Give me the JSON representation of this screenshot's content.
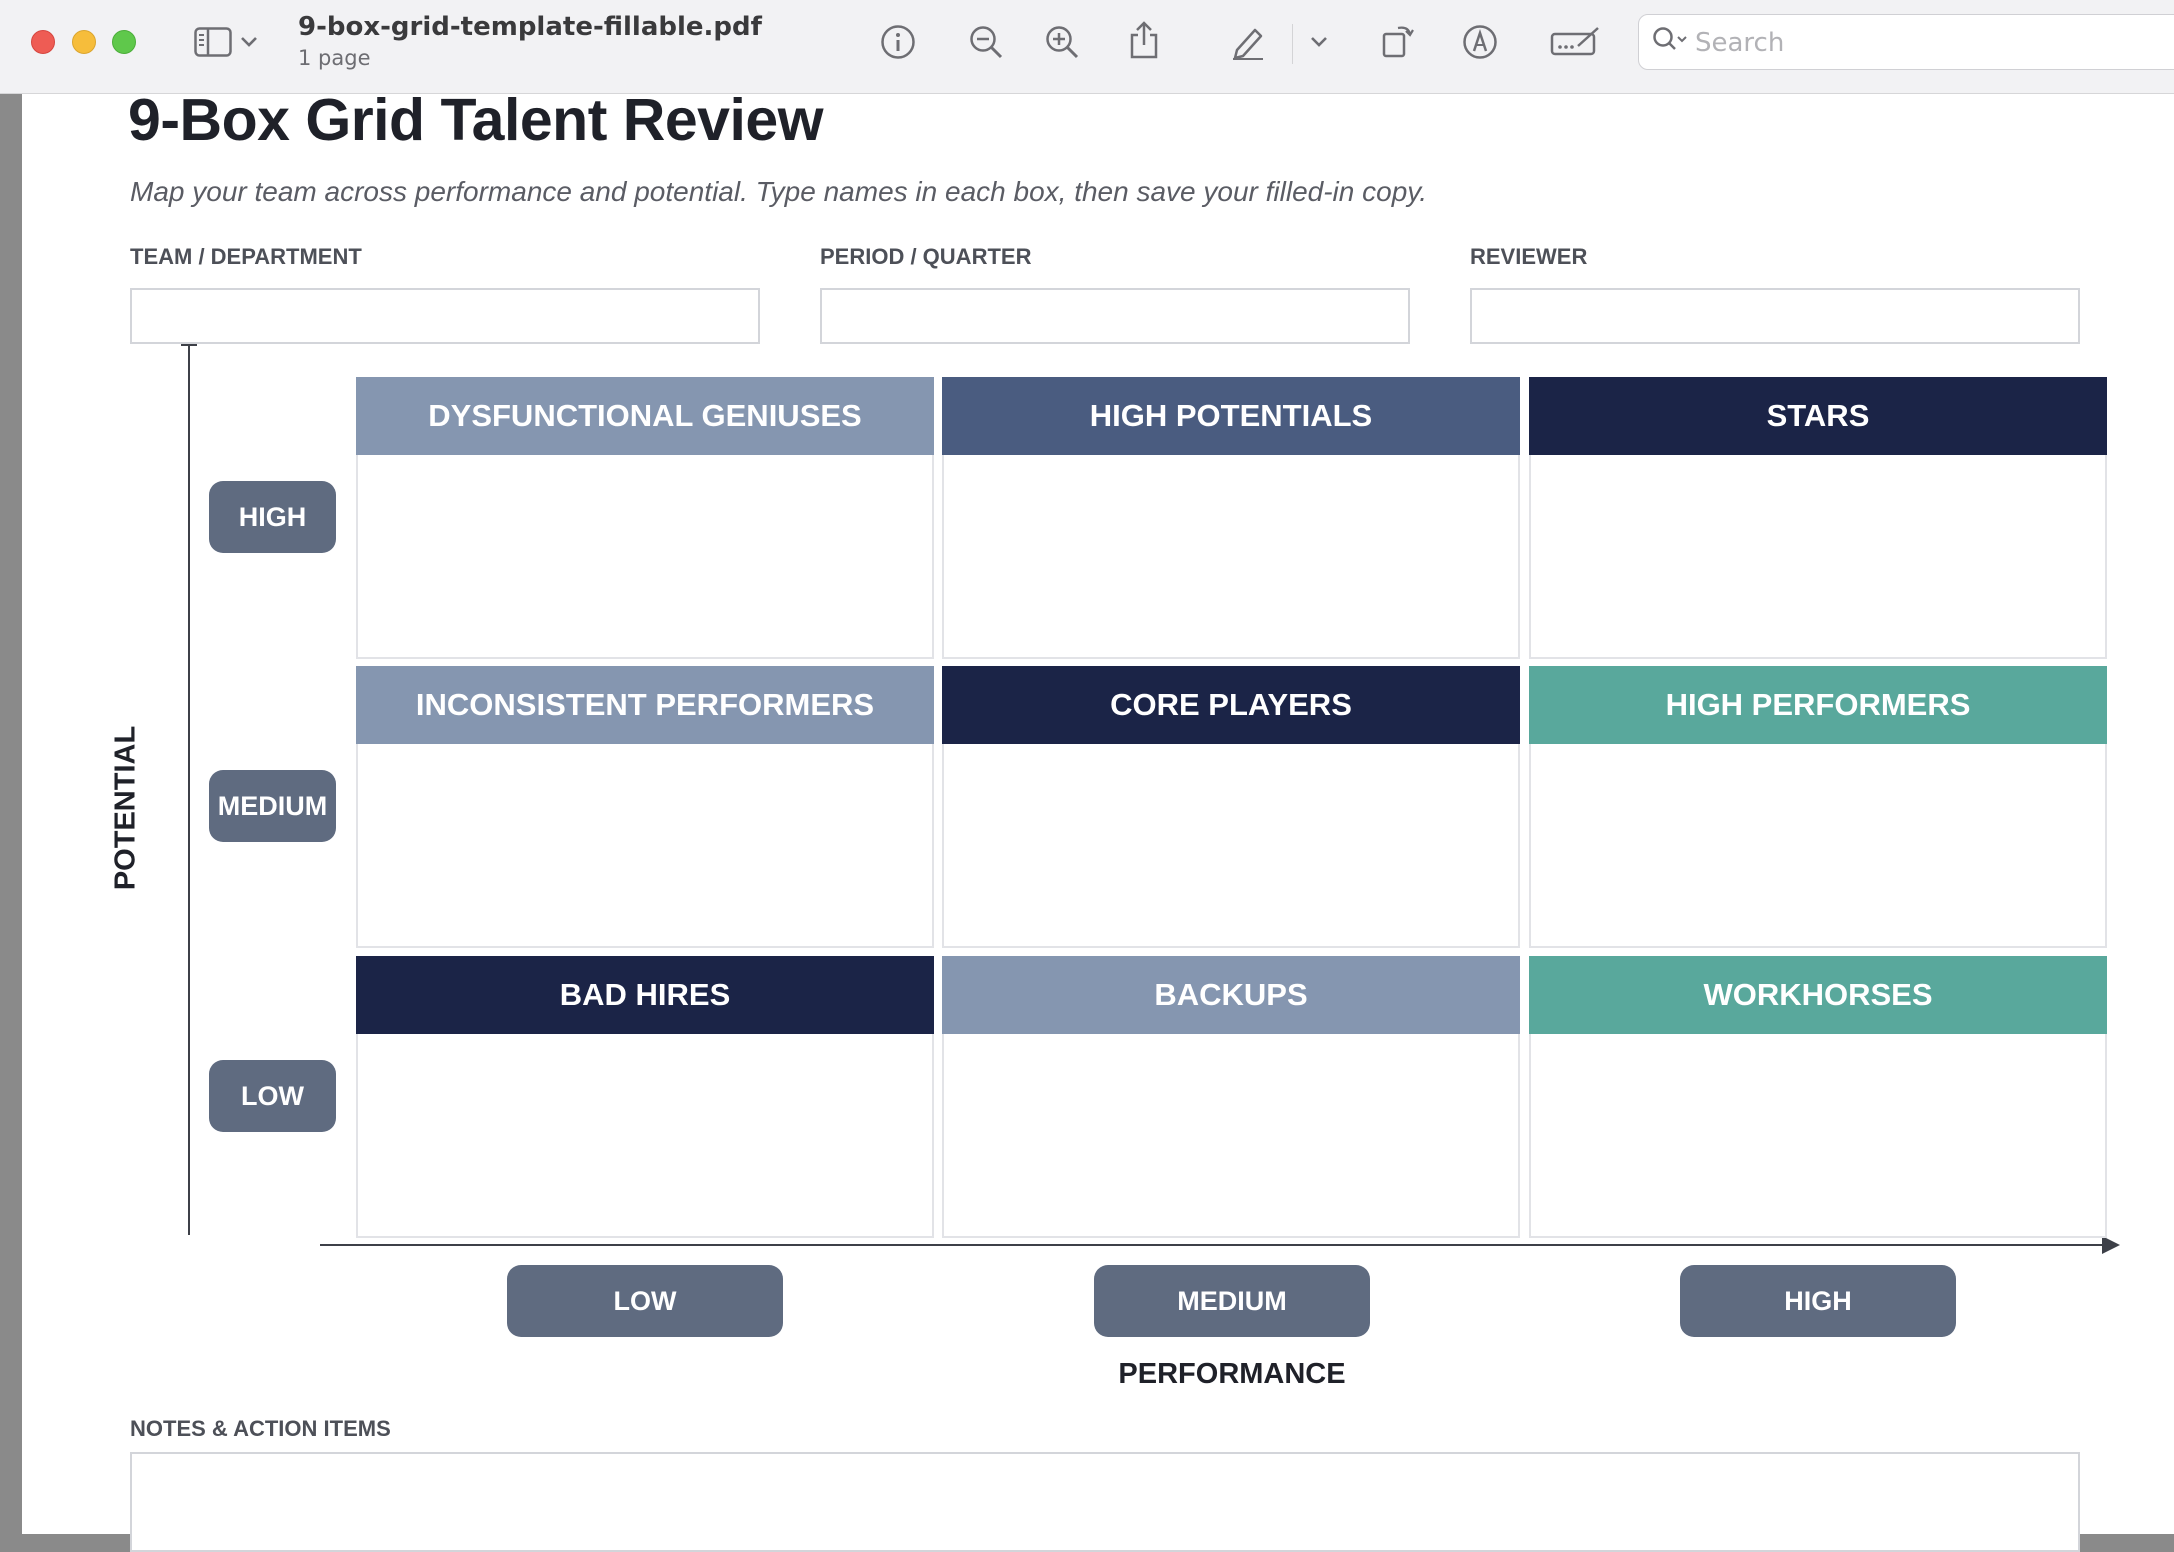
{
  "window": {
    "file_name": "9-box-grid-template-fillable.pdf",
    "page_count": "1 page"
  },
  "toolbar": {
    "icons": [
      "sidebar-icon",
      "chevron-down-icon",
      "info-icon",
      "zoom-out-icon",
      "zoom-in-icon",
      "share-icon",
      "highlighter-pen-icon",
      "chevron-down-icon",
      "rotate-icon",
      "markup-icon",
      "form-fill-icon",
      "search-icon"
    ],
    "search_placeholder": "Search"
  },
  "document": {
    "title": "9-Box Grid Talent Review",
    "subtitle": "Map your team across performance and potential. Type names in each box, then save your filled-in copy.",
    "fields": {
      "team_label": "TEAM / DEPARTMENT",
      "team_value": "",
      "period_label": "PERIOD / QUARTER",
      "period_value": "",
      "reviewer_label": "REVIEWER",
      "reviewer_value": ""
    },
    "axes": {
      "y_title": "POTENTIAL",
      "y_levels": [
        "HIGH",
        "MEDIUM",
        "LOW"
      ],
      "x_title": "PERFORMANCE",
      "x_levels": [
        "LOW",
        "MEDIUM",
        "HIGH"
      ]
    },
    "grid": {
      "rows": [
        [
          {
            "label": "DYSFUNCTIONAL GENIUSES",
            "color": "#8596b0",
            "value": ""
          },
          {
            "label": "HIGH POTENTIALS",
            "color": "#4a5c80",
            "value": ""
          },
          {
            "label": "STARS",
            "color": "#1b2447",
            "value": ""
          }
        ],
        [
          {
            "label": "INCONSISTENT PERFORMERS",
            "color": "#8596b0",
            "value": ""
          },
          {
            "label": "CORE PLAYERS",
            "color": "#1b2447",
            "value": ""
          },
          {
            "label": "HIGH PERFORMERS",
            "color": "#59a89c",
            "value": ""
          }
        ],
        [
          {
            "label": "BAD HIRES",
            "color": "#1b2447",
            "value": ""
          },
          {
            "label": "BACKUPS",
            "color": "#8596b0",
            "value": ""
          },
          {
            "label": "WORKHORSES",
            "color": "#59a89c",
            "value": ""
          }
        ]
      ]
    },
    "notes": {
      "label": "NOTES & ACTION ITEMS",
      "value": ""
    }
  }
}
